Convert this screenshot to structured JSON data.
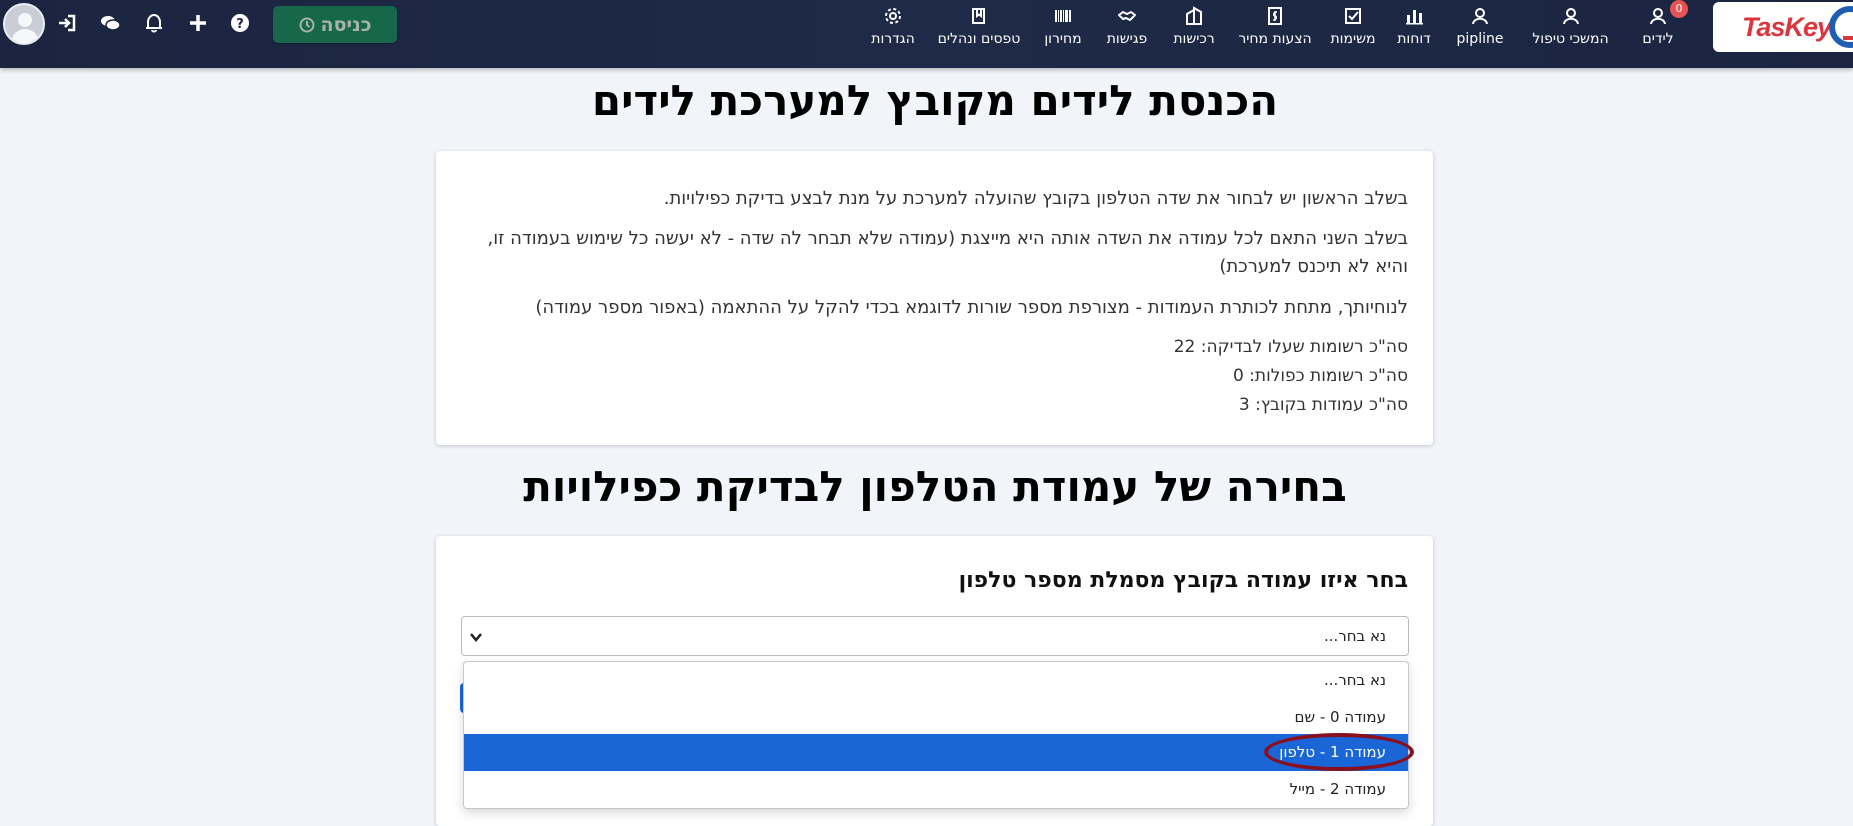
{
  "brand": {
    "name": "TasKey"
  },
  "nav": {
    "items": [
      {
        "name": "nav-leads",
        "label": "לידים",
        "icon": "user-rings-icon",
        "badge": "0"
      },
      {
        "name": "nav-handling-handlers",
        "label": "המשכי טיפול",
        "icon": "user-rings-icon"
      },
      {
        "name": "nav-pipeline",
        "label": "pipline",
        "icon": "user-rings-icon"
      },
      {
        "name": "nav-reports",
        "label": "דוחות",
        "icon": "bar-chart-icon"
      },
      {
        "name": "nav-tasks",
        "label": "משימות",
        "icon": "checkbox-icon"
      },
      {
        "name": "nav-quotes",
        "label": "הצעות מחיר",
        "icon": "document-dollar-icon"
      },
      {
        "name": "nav-purchases",
        "label": "רכישות",
        "icon": "building-icon"
      },
      {
        "name": "nav-meetings",
        "label": "פגישות",
        "icon": "handshake-icon"
      },
      {
        "name": "nav-pricelist",
        "label": "מחירון",
        "icon": "barcode-icon"
      },
      {
        "name": "nav-forms",
        "label": "טפסים ונהלים",
        "icon": "book-icon"
      },
      {
        "name": "nav-settings",
        "label": "הגדרות",
        "icon": "gear-icon"
      }
    ]
  },
  "toolbar": {
    "enter_label": "כניסה",
    "icons": [
      "clock-icon",
      "help-icon",
      "plus-icon",
      "bell-icon",
      "chat-icon",
      "login-icon",
      "avatar"
    ]
  },
  "page": {
    "title": "הכנסת לידים מקובץ למערכת לידים",
    "instructions": [
      "בשלב הראשון יש לבחור את שדה הטלפון בקובץ שהועלה למערכת על מנת לבצע בדיקת כפילויות.",
      "בשלב השני התאם לכל עמודה את השדה אותה היא מייצגת (עמודה שלא תבחר לה שדה - לא יעשה כל שימוש בעמודה זו, והיא לא תיכנס למערכת)",
      "לנוחיותך, מתחת לכותרת העמודות - מצורפת מספר שורות לדוגמא בכדי להקל על ההתאמה (באפור מספר עמודה)"
    ],
    "stats": [
      "סה\"כ רשומות שעלו לבדיקה: 22",
      "סה\"כ רשומות כפולות: 0",
      "סה\"כ עמודות בקובץ: 3"
    ],
    "section_title": "בחירה של עמודת הטלפון לבדיקת כפילויות",
    "select_label": "בחר איזו עמודה בקובץ מסמלת מספר טלפון",
    "select_value": "נא בחר...",
    "options": [
      "נא בחר...",
      "עמודה 0 - שם",
      "עמודה 1 - טלפון",
      "עמודה 2 - מייל"
    ],
    "highlighted_option": "עמודה 1 - טלפון"
  },
  "colors": {
    "navbar": "#1c2540",
    "enter_button": "#17674a",
    "highlight": "#1a66d6",
    "annotation_ring": "#8a1020"
  }
}
